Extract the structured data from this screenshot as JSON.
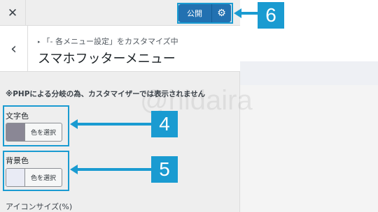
{
  "topbar": {
    "close_icon_glyph": "✕",
    "publish_label": "公開",
    "gear_glyph": "⚙"
  },
  "section": {
    "back_glyph": "‹",
    "breadcrumb": "「- 各メニュー設定」をカスタマイズ中",
    "title": "スマホフッターメニュー"
  },
  "notice": "※PHPによる分岐の為、カスタマイザーでは表示されません",
  "text_color": {
    "label": "文字色",
    "button_label": "色を選択",
    "swatch_color": "#8a8795"
  },
  "bg_color": {
    "label": "背景色",
    "button_label": "色を選択",
    "swatch_color": "#e9ebf5"
  },
  "icon_size_label": "アイコンサイズ(%)",
  "callouts": {
    "c4": "4",
    "c5": "5",
    "c6": "6"
  },
  "watermark": "@hidaira",
  "colors": {
    "accent": "#1a9bd1",
    "publish": "#2271b1"
  }
}
